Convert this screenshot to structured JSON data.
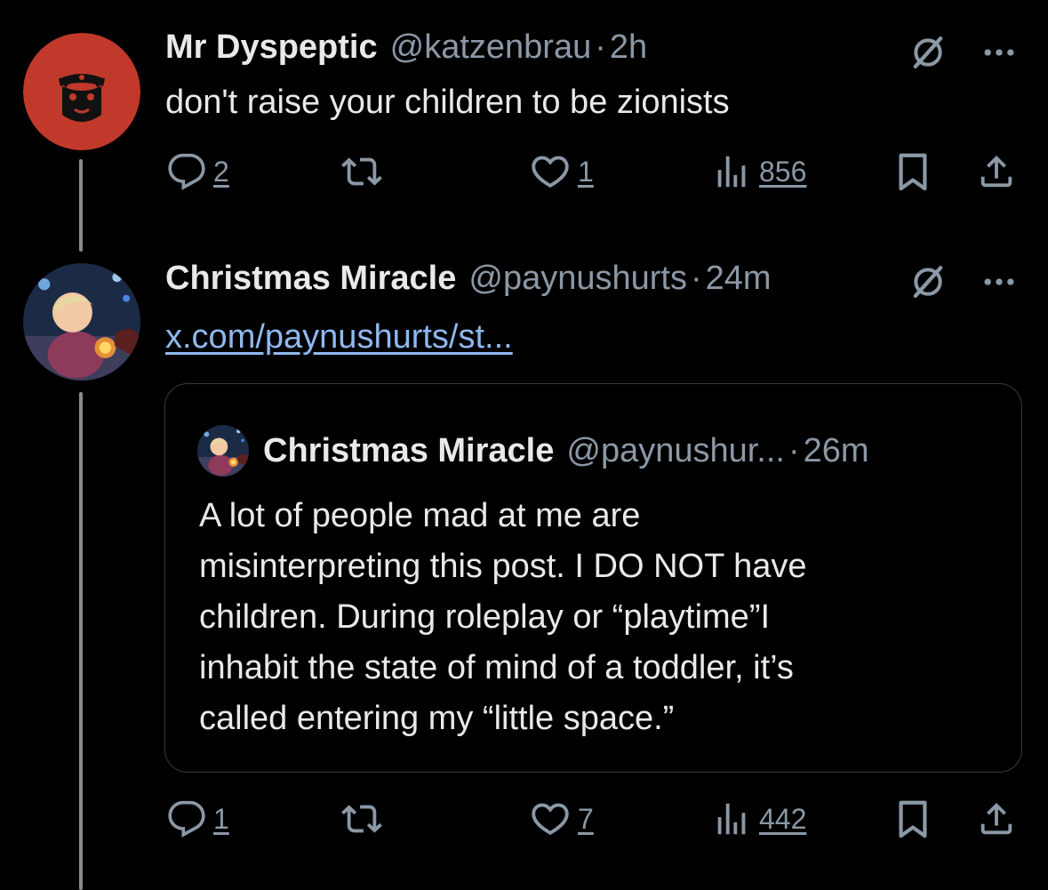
{
  "posts": [
    {
      "display_name": "Mr Dyspeptic",
      "handle": "@katzenbrau",
      "separator": "·",
      "time": "2h",
      "text": "don't raise your children to be zionists",
      "replies": "2",
      "likes": "1",
      "views": "856",
      "avatar_bg": "#c0392b"
    },
    {
      "display_name": "Christmas Miracle",
      "handle": "@paynushurts",
      "separator": "·",
      "time": "24m",
      "link_text": "x.com/paynushurts/st...",
      "replies": "1",
      "likes": "7",
      "views": "442",
      "quote": {
        "display_name": "Christmas Miracle",
        "handle": "@paynushur...",
        "separator": "·",
        "time": "26m",
        "lines": [
          "A lot of people mad at me are",
          "misinterpreting this post. I DO NOT have",
          "children. During roleplay or “playtime”I",
          "inhabit the state of mind of a toddler, it’s",
          "called entering my “little space.”"
        ]
      }
    }
  ],
  "icons": {
    "grok": "grok-icon",
    "more": "more-icon",
    "reply": "reply-icon",
    "repost": "repost-icon",
    "like": "like-icon",
    "views": "views-icon",
    "bookmark": "bookmark-icon",
    "share": "share-icon"
  },
  "colors": {
    "background": "#000000",
    "text": "#e7e9ea",
    "secondary": "#8b98a5",
    "link": "#8fb8ef",
    "thread_line": "#8b8b8b"
  }
}
